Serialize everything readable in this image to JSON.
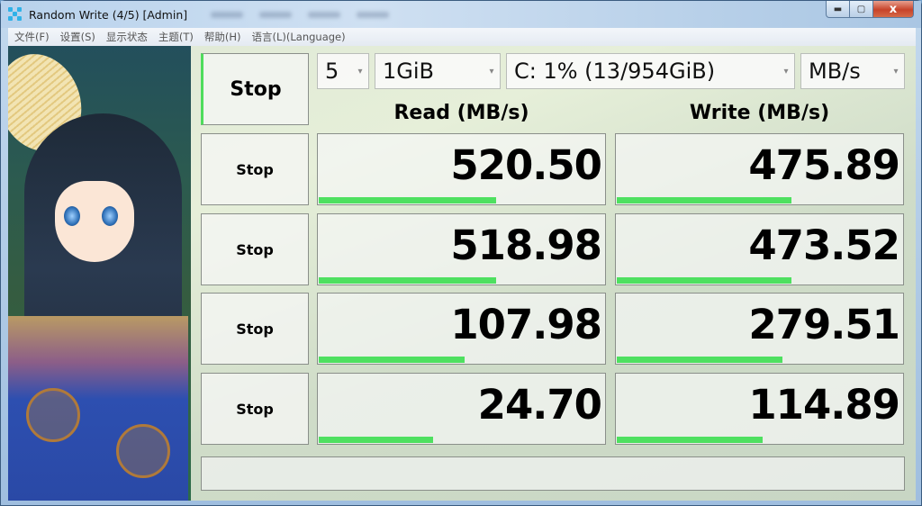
{
  "window": {
    "title": "Random Write (4/5) [Admin]",
    "controls": {
      "minimize_icon": "minimize-icon",
      "maximize_icon": "maximize-icon",
      "close_label": "x"
    }
  },
  "menu": [
    {
      "label": "文件(F)"
    },
    {
      "label": "设置(S)"
    },
    {
      "label": "显示状态"
    },
    {
      "label": "主题(T)"
    },
    {
      "label": "帮助(H)"
    },
    {
      "label": "语言(L)(Language)"
    }
  ],
  "controls": {
    "all_button_label": "Stop",
    "count": "5",
    "size": "1GiB",
    "drive": "C: 1% (13/954GiB)",
    "unit": "MB/s"
  },
  "headers": {
    "read": "Read (MB/s)",
    "write": "Write (MB/s)"
  },
  "rows": [
    {
      "button": "Stop",
      "read": "520.50",
      "read_fill": 0.62,
      "write": "475.89",
      "write_fill": 0.61
    },
    {
      "button": "Stop",
      "read": "518.98",
      "read_fill": 0.62,
      "write": "473.52",
      "write_fill": 0.61
    },
    {
      "button": "Stop",
      "read": "107.98",
      "read_fill": 0.51,
      "write": "279.51",
      "write_fill": 0.58
    },
    {
      "button": "Stop",
      "read": "24.70",
      "read_fill": 0.4,
      "write": "114.89",
      "write_fill": 0.51
    }
  ],
  "status_text": "",
  "colors": {
    "bar": "#4ee060",
    "accent": "#4fdc5c"
  }
}
